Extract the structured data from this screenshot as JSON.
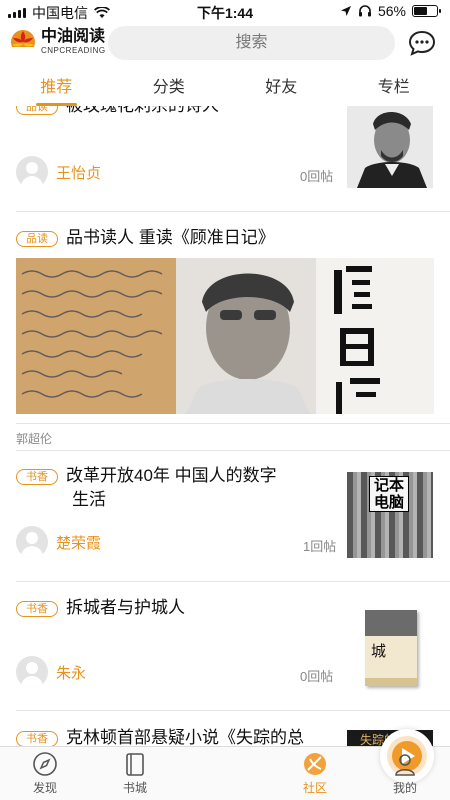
{
  "status": {
    "carrier": "中国电信",
    "time": "下午1:44",
    "battery": "56%"
  },
  "header": {
    "logo_line1": "中油阅读",
    "logo_line2": "CNPCREADING",
    "search_placeholder": "搜索"
  },
  "tabs": [
    {
      "label": "推荐",
      "active": true
    },
    {
      "label": "分类",
      "active": false
    },
    {
      "label": "好友",
      "active": false
    },
    {
      "label": "专栏",
      "active": false
    }
  ],
  "posts": [
    {
      "badge": "品读",
      "title": "被玫瑰花刺杀的诗人",
      "author": "王怡贞",
      "replies": "0回帖"
    },
    {
      "badge": "品读",
      "title": "品书读人  重读《顾准日记》",
      "author": "郭超伦"
    },
    {
      "badge": "书香",
      "title": "改革开放40年 中国人的数字",
      "title2": "生活",
      "author": "楚荣霞",
      "replies": "1回帖"
    },
    {
      "badge": "书香",
      "title": "拆城者与护城人",
      "author": "朱永",
      "replies": "0回帖"
    },
    {
      "badge": "书香",
      "title": "克林顿首部悬疑小说《失踪的总"
    }
  ],
  "thumb_texts": {
    "book2_title": "记本电脑",
    "book3_title": "城",
    "book4_title": "失踪的总统"
  },
  "bottom_nav": [
    {
      "label": "发现",
      "icon": "compass-icon"
    },
    {
      "label": "书城",
      "icon": "book-icon"
    },
    {
      "label": "社区",
      "icon": "community-icon",
      "active": true
    },
    {
      "label": "我的",
      "icon": "user-icon"
    }
  ],
  "colors": {
    "accent": "#e8921e"
  }
}
